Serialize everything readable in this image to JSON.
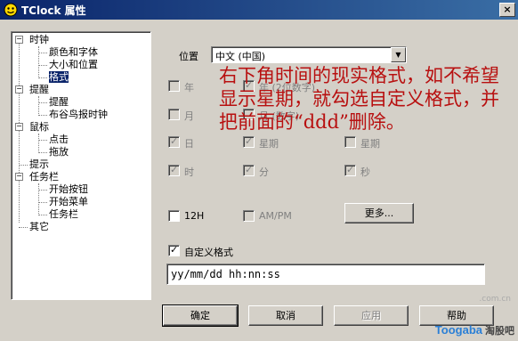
{
  "window": {
    "title": "TClock 属性",
    "close_glyph": "×"
  },
  "tree": {
    "items": [
      {
        "label": "时钟"
      },
      {
        "label": "颜色和字体"
      },
      {
        "label": "大小和位置"
      },
      {
        "label": "格式"
      },
      {
        "label": "提醒"
      },
      {
        "label": "提醒"
      },
      {
        "label": "布谷鸟报时钟"
      },
      {
        "label": "鼠标"
      },
      {
        "label": "点击"
      },
      {
        "label": "拖放"
      },
      {
        "label": "提示"
      },
      {
        "label": "任务栏"
      },
      {
        "label": "开始按钮"
      },
      {
        "label": "开始菜单"
      },
      {
        "label": "任务栏"
      },
      {
        "label": "其它"
      }
    ]
  },
  "location": {
    "label": "位置",
    "value": "中文 (中国)"
  },
  "checks": {
    "year": "年",
    "year_full": "年 (2位数字)",
    "month": "月",
    "month_abbr": "月 (数字)",
    "day": "日",
    "weekday": "星期",
    "weekday_abbr": "星期",
    "hour": "时",
    "minute": "分",
    "second": "秒",
    "hour12": "12H",
    "ampm": "AM/PM"
  },
  "more_button": "更多...",
  "custom_format": {
    "label": "自定义格式",
    "value": "yy/mm/dd hh:nn:ss"
  },
  "buttons": {
    "ok": "确定",
    "cancel": "取消",
    "apply": "应用",
    "help": "帮助"
  },
  "annotation": "右下角时间的现实格式，如不希望显示星期，就勾选自定义格式，并把前面的“ddd”删除。",
  "watermark": {
    "brand": "Toogaba",
    "cn": "淘股吧",
    "domain": ".com.cn"
  }
}
